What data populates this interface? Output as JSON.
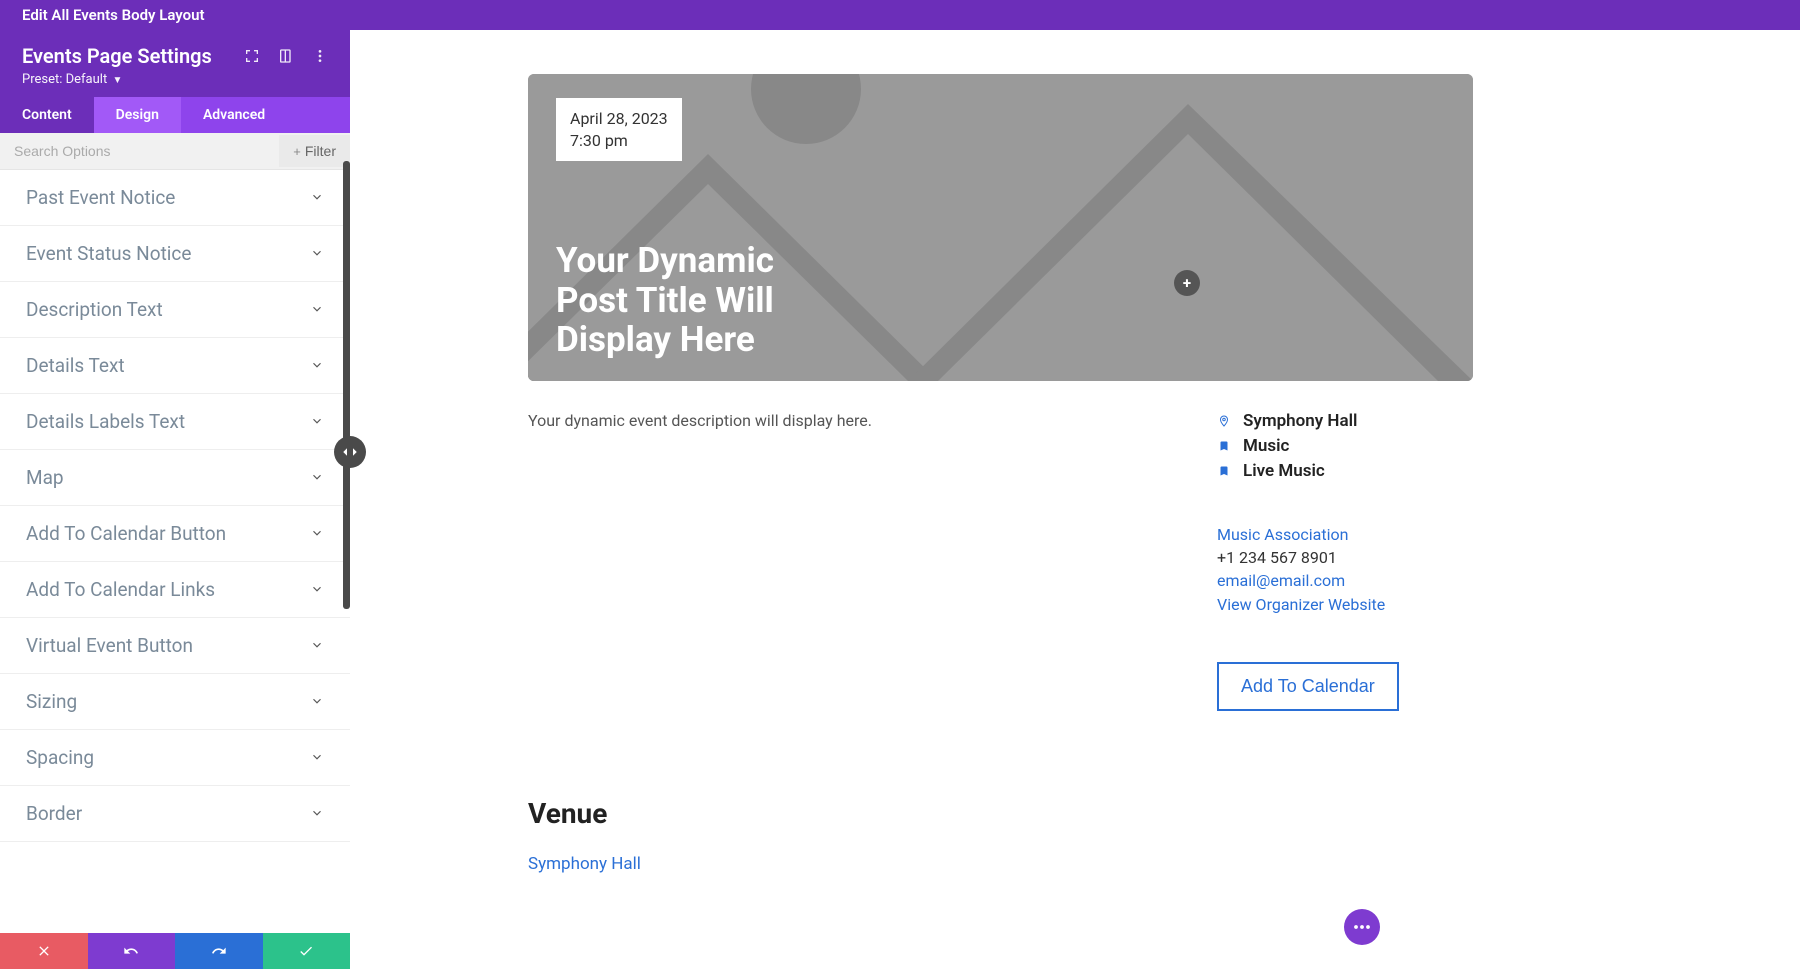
{
  "topbar": {
    "title": "Edit All Events Body Layout"
  },
  "settings": {
    "title": "Events Page Settings",
    "preset_prefix": "Preset: ",
    "preset_value": "Default"
  },
  "tabs": {
    "content": "Content",
    "design": "Design",
    "advanced": "Advanced"
  },
  "search": {
    "placeholder": "Search Options",
    "filter_label": "Filter"
  },
  "options": [
    {
      "label": "Past Event Notice"
    },
    {
      "label": "Event Status Notice"
    },
    {
      "label": "Description Text"
    },
    {
      "label": "Details Text"
    },
    {
      "label": "Details Labels Text"
    },
    {
      "label": "Map"
    },
    {
      "label": "Add To Calendar Button"
    },
    {
      "label": "Add To Calendar Links"
    },
    {
      "label": "Virtual Event Button"
    },
    {
      "label": "Sizing"
    },
    {
      "label": "Spacing"
    },
    {
      "label": "Border"
    }
  ],
  "hero": {
    "date": "April 28, 2023",
    "time": "7:30 pm",
    "title": "Your Dynamic Post Title Will Display Here"
  },
  "description": "Your dynamic event description will display here.",
  "meta": {
    "location": "Symphony Hall",
    "category1": "Music",
    "category2": "Live Music"
  },
  "organizer": {
    "name": "Music Association",
    "phone": "+1 234 567 8901",
    "email": "email@email.com",
    "website_label": "View Organizer Website"
  },
  "add_to_calendar": "Add To Calendar",
  "venue": {
    "heading": "Venue",
    "name": "Symphony Hall"
  }
}
